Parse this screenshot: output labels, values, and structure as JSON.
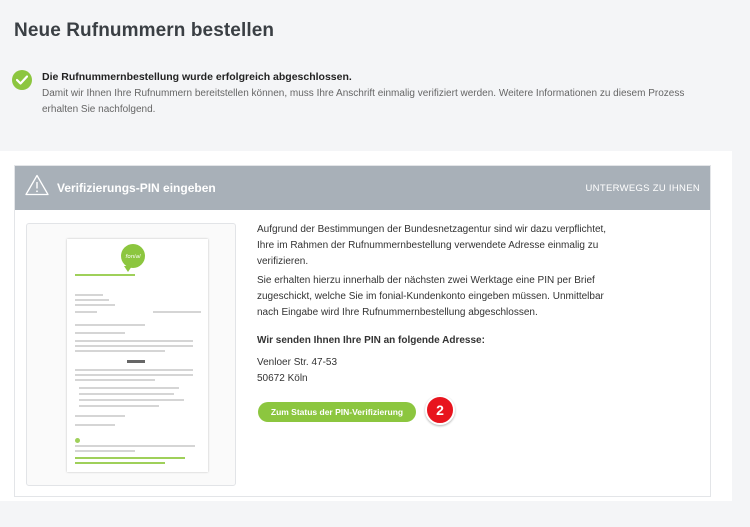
{
  "page": {
    "title": "Neue Rufnummern bestellen"
  },
  "success": {
    "title": "Die Rufnummernbestellung wurde erfolgreich abgeschlossen.",
    "text": "Damit wir Ihnen Ihre Rufnummern bereitstellen können, muss Ihre Anschrift einmalig verifiziert werden. Weitere Informationen zu diesem Prozess erhalten Sie nachfolgend."
  },
  "card": {
    "title": "Verifizierungs-PIN eingeben",
    "status": "UNTERWEGS ZU IHNEN",
    "paragraph1": "Aufgrund der Bestimmungen der Bundesnetzagentur sind wir dazu verpflichtet, Ihre im Rahmen der Rufnummernbestellung verwendete Adresse einmalig zu verifizieren.",
    "paragraph2": "Sie erhalten hierzu innerhalb der nächsten zwei Werktage eine PIN per Brief zugeschickt, welche Sie im fonial-Kundenkonto eingeben müssen. Unmittelbar nach Eingabe wird Ihre Rufnummernbestellung abgeschlossen.",
    "address_heading": "Wir senden Ihnen Ihre PIN an folgende Adresse:",
    "address_line1": "Venloer Str. 47-53",
    "address_line2": "50672 Köln",
    "cta_label": "Zum Status der PIN-Verifizierung",
    "badge": "2",
    "logo_text": "fonial"
  },
  "colors": {
    "accent": "#8cc63f",
    "header": "#a8b0b8",
    "badge": "#e8141e"
  },
  "icons": {
    "success": "check-circle-icon",
    "header": "warning-triangle-icon"
  }
}
